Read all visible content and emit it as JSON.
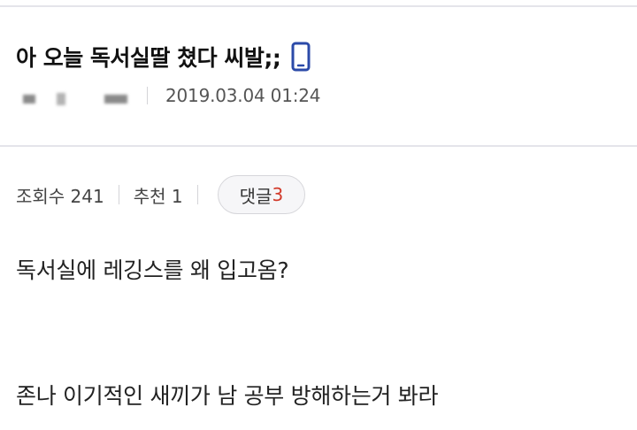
{
  "post": {
    "title": "아 오늘 독서실딸 쳤다 씨발;;",
    "date": "2019.03.04 01:24"
  },
  "stats": {
    "views": "조회수 241",
    "recommends": "추천 1",
    "comments_label": "댓글",
    "comments_count": "3"
  },
  "body": {
    "lines": [
      "독서실에 레깅스를 왜 입고옴?",
      "존나 이기적인 새끼가 남 공부 방해하는거 봐라"
    ]
  },
  "icons": {
    "title_badge": "mobile-phone-icon"
  },
  "colors": {
    "accent_icon": "#2b4aa8",
    "comment_count": "#d23a2a"
  }
}
